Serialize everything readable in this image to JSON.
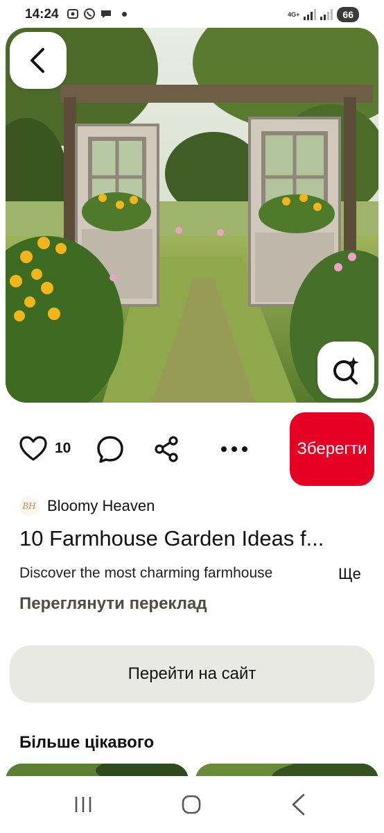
{
  "status_bar": {
    "time": "14:24",
    "network": "4G+",
    "battery": "66"
  },
  "pin": {
    "like_count": "10",
    "save_label": "Зберегти",
    "author_initials": "BH",
    "author_name": "Bloomy Heaven",
    "title": "10 Farmhouse Garden Ideas f...",
    "description": "Discover the most charming farmhouse",
    "more_label": "Ще",
    "translate_label": "Переглянути переклад",
    "visit_label": "Перейти на сайт"
  },
  "more_section": {
    "heading": "Більше цікавого"
  },
  "icons": {
    "back": "chevron-left-icon",
    "lens": "visual-search-icon",
    "like": "heart-icon",
    "comment": "comment-icon",
    "share": "share-icon",
    "more": "more-dots-icon"
  },
  "colors": {
    "save_button": "#e60023",
    "visit_button": "#e9e9e3",
    "translate_text": "#4d4d40"
  }
}
